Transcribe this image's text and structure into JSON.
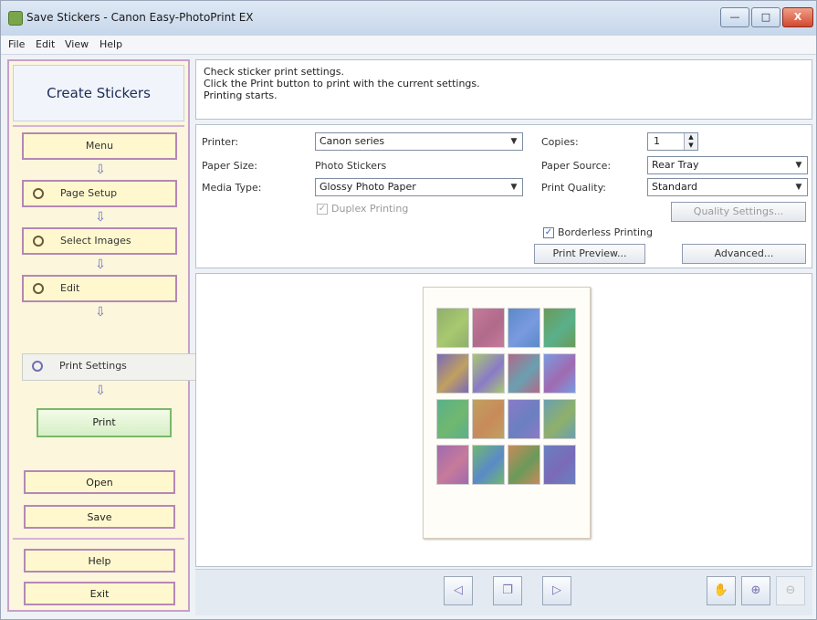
{
  "window": {
    "title": "Save Stickers - Canon Easy-PhotoPrint EX",
    "min_label": "—",
    "max_label": "□",
    "close_label": "X"
  },
  "menu": [
    "File",
    "Edit",
    "View",
    "Help"
  ],
  "sidebar": {
    "title": "Create Stickers",
    "steps": [
      {
        "label": "Menu",
        "icon": "menu-icon"
      },
      {
        "label": "Page Setup",
        "icon": "page-setup-icon"
      },
      {
        "label": "Select Images",
        "icon": "select-images-icon"
      },
      {
        "label": "Edit",
        "icon": "edit-icon"
      },
      {
        "label": "Print Settings",
        "icon": "print-settings-icon"
      }
    ],
    "arrow_glyph": "⇩",
    "print_button": "Print",
    "open_button": "Open",
    "save_button": "Save",
    "help_button": "Help",
    "exit_button": "Exit"
  },
  "instructions": {
    "line1": "Check sticker print settings.",
    "line2": "Click the Print button to print with the current settings.",
    "line3": "Printing starts."
  },
  "settings": {
    "printer_label": "Printer:",
    "printer_value": "Canon series",
    "paper_size_label": "Paper Size:",
    "paper_size_value": "Photo Stickers",
    "media_type_label": "Media Type:",
    "media_type_value": "Glossy Photo Paper",
    "duplex_label": "Duplex Printing",
    "copies_label": "Copies:",
    "copies_value": "1",
    "paper_source_label": "Paper Source:",
    "paper_source_value": "Rear Tray",
    "print_quality_label": "Print Quality:",
    "print_quality_value": "Standard",
    "quality_settings_button": "Quality Settings...",
    "borderless_label": "Borderless Printing",
    "print_preview_button": "Print Preview...",
    "advanced_button": "Advanced..."
  },
  "preview": {
    "sticker_colors": [
      "#8fb06a",
      "#c77a9a",
      "#5a8ac8",
      "#6a9a5a",
      "#7a6ab8",
      "#a8c870",
      "#b06a8a",
      "#7a9ae0",
      "#5ab08a",
      "#c0a060",
      "#8a7ac8",
      "#6aa0b0",
      "#a06ab0",
      "#70b870",
      "#c88a5a",
      "#6a80c0"
    ]
  },
  "toolbar": {
    "prev_glyph": "◁",
    "page_glyph": "❐",
    "next_glyph": "▷",
    "hand_glyph": "✋",
    "zoom_in_glyph": "⊕",
    "zoom_out_glyph": "⊖"
  }
}
